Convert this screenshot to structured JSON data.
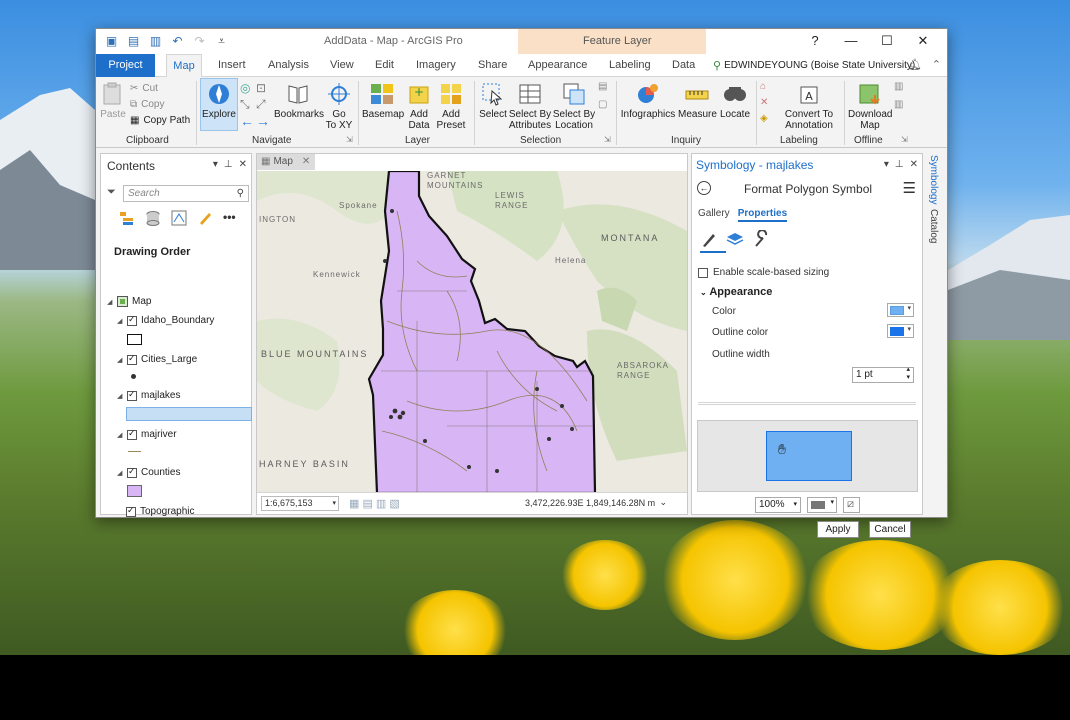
{
  "window": {
    "title": "AddData - Map - ArcGIS Pro",
    "context_tab_group": "Feature Layer",
    "help": "?",
    "minimize": "—",
    "maximize": "☐",
    "close": "✕"
  },
  "tabs": {
    "project": "Project",
    "map": "Map",
    "insert": "Insert",
    "analysis": "Analysis",
    "view": "View",
    "edit": "Edit",
    "imagery": "Imagery",
    "share": "Share",
    "appearance": "Appearance",
    "labeling": "Labeling",
    "data": "Data",
    "user": "EDWINDEYOUNG (Boise State University)"
  },
  "ribbon": {
    "clipboard": {
      "paste": "Paste",
      "cut": "Cut",
      "copy": "Copy",
      "copy_path": "Copy Path",
      "label": "Clipboard"
    },
    "navigate": {
      "explore": "Explore",
      "bookmarks": "Bookmarks",
      "goto_1": "Go",
      "goto_2": "To XY",
      "label": "Navigate"
    },
    "layer": {
      "basemap": "Basemap",
      "add_data_1": "Add",
      "add_data_2": "Data",
      "add_preset_1": "Add",
      "add_preset_2": "Preset",
      "label": "Layer"
    },
    "selection": {
      "select": "Select",
      "by_attr_1": "Select By",
      "by_attr_2": "Attributes",
      "by_loc_1": "Select By",
      "by_loc_2": "Location",
      "label": "Selection"
    },
    "inquiry": {
      "infographics": "Infographics",
      "measure": "Measure",
      "locate": "Locate",
      "label": "Inquiry"
    },
    "labeling": {
      "convert_1": "Convert To",
      "convert_2": "Annotation",
      "label": "Labeling"
    },
    "offline": {
      "download_1": "Download",
      "download_2": "Map",
      "label": "Offline"
    }
  },
  "contents": {
    "title": "Contents",
    "search_placeholder": "Search",
    "drawing_order": "Drawing Order",
    "layers": [
      {
        "name": "Map"
      },
      {
        "name": "Idaho_Boundary"
      },
      {
        "name": "Cities_Large"
      },
      {
        "name": "majlakes"
      },
      {
        "name": "majriver"
      },
      {
        "name": "Counties"
      },
      {
        "name": "Topographic"
      }
    ]
  },
  "map": {
    "tab": "Map",
    "labels": {
      "spokane": "Spokane",
      "kennewick": "Kennewick",
      "helena": "Helena",
      "montana": "MONTANA",
      "lewis_range": "LEWIS RANGE",
      "garnet": "GARNET MOUNTAINS",
      "blue_mtns": "BLUE MOUNTAINS",
      "absaroka": "ABSAROKA RANGE",
      "harney": "HARNEY BASIN",
      "ington": "INGTON"
    },
    "scale": "1:6,675,153",
    "coordinates": "3,472,226.93E 1,849,146.28N m"
  },
  "symbology": {
    "title": "Symbology - majlakes",
    "header": "Format Polygon Symbol",
    "gallery": "Gallery",
    "properties": "Properties",
    "scale_sizing": "Enable scale-based sizing",
    "appearance": "Appearance",
    "color_label": "Color",
    "outline_color_label": "Outline color",
    "outline_width_label": "Outline width",
    "outline_width_value": "1 pt",
    "zoom": "100%",
    "apply": "Apply",
    "cancel": "Cancel",
    "fill_color": "#6eb0f2",
    "outline_color": "#1a73e8"
  },
  "side_tabs": {
    "symbology": "Symbology",
    "catalog": "Catalog"
  }
}
